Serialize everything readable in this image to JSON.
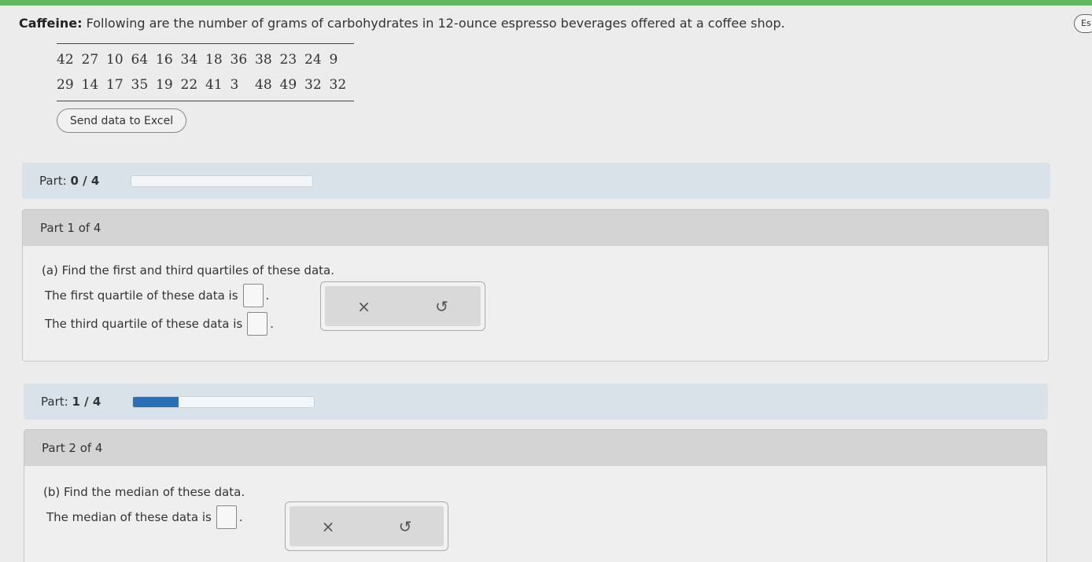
{
  "problem": {
    "label": "Caffeine:",
    "text": "Following are the number of grams of carbohydrates in 12-ounce espresso beverages offered at a coffee shop."
  },
  "data_rows": [
    [
      "42",
      "27",
      "10",
      "64",
      "16",
      "34",
      "18",
      "36",
      "38",
      "23",
      "24",
      "9"
    ],
    [
      "29",
      "14",
      "17",
      "35",
      "19",
      "22",
      "41",
      "3",
      "48",
      "49",
      "32",
      "32"
    ]
  ],
  "send_excel_label": "Send data to Excel",
  "side_button_label": "Es",
  "progress_1": {
    "label": "Part:",
    "value": "0 / 4",
    "fraction": 0
  },
  "part1": {
    "heading": "Part 1 of 4",
    "question": "(a) Find the first and third quartiles of these data.",
    "line1": "The first quartile of these data is",
    "line2": "The third quartile of these data is"
  },
  "progress_2": {
    "label": "Part:",
    "value": "1 / 4",
    "fraction": 0.25
  },
  "part2": {
    "heading": "Part 2 of 4",
    "question": "(b) Find the median of these data.",
    "line1": "The median of these data is"
  },
  "tools": {
    "clear_icon": "×",
    "undo_icon": "↺"
  },
  "colors": {
    "accent_green": "#5fb760",
    "progress_blue": "#2a6fb8",
    "part_bar_bg": "#d9e2e8"
  }
}
